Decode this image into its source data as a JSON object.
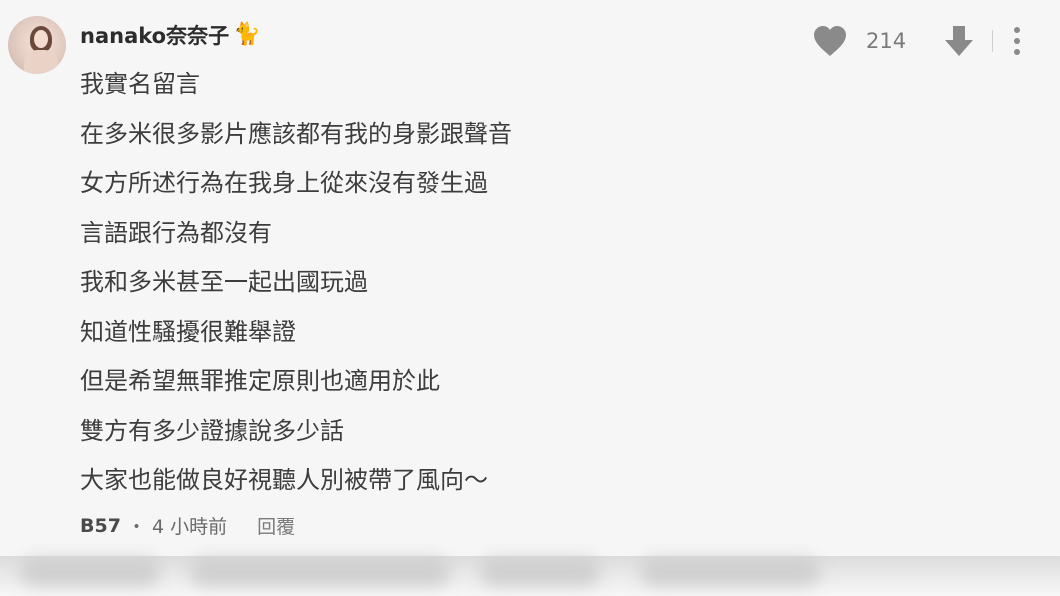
{
  "comment": {
    "author": "nanako奈奈子",
    "author_emoji": "🐈",
    "lines": [
      "我實名留言",
      "在多米很多影片應該都有我的身影跟聲音",
      "女方所述行為在我身上從來沒有發生過",
      "言語跟行為都沒有",
      "我和多米甚至一起出國玩過",
      "知道性騷擾很難舉證",
      "但是希望無罪推定原則也適用於此",
      "雙方有多少證據說多少話",
      "大家也能做良好視聽人別被帶了風向～"
    ],
    "author_code": "B57",
    "separator": "・",
    "time": "4 小時前",
    "reply_label": "回覆",
    "like_count": "214"
  },
  "icons": {
    "like": "heart-icon",
    "dislike": "down-arrow-icon",
    "more": "more-vertical-icon"
  },
  "colors": {
    "background": "#f6f6f6",
    "icon": "#8a8a8a",
    "text": "#3d3d3d"
  }
}
